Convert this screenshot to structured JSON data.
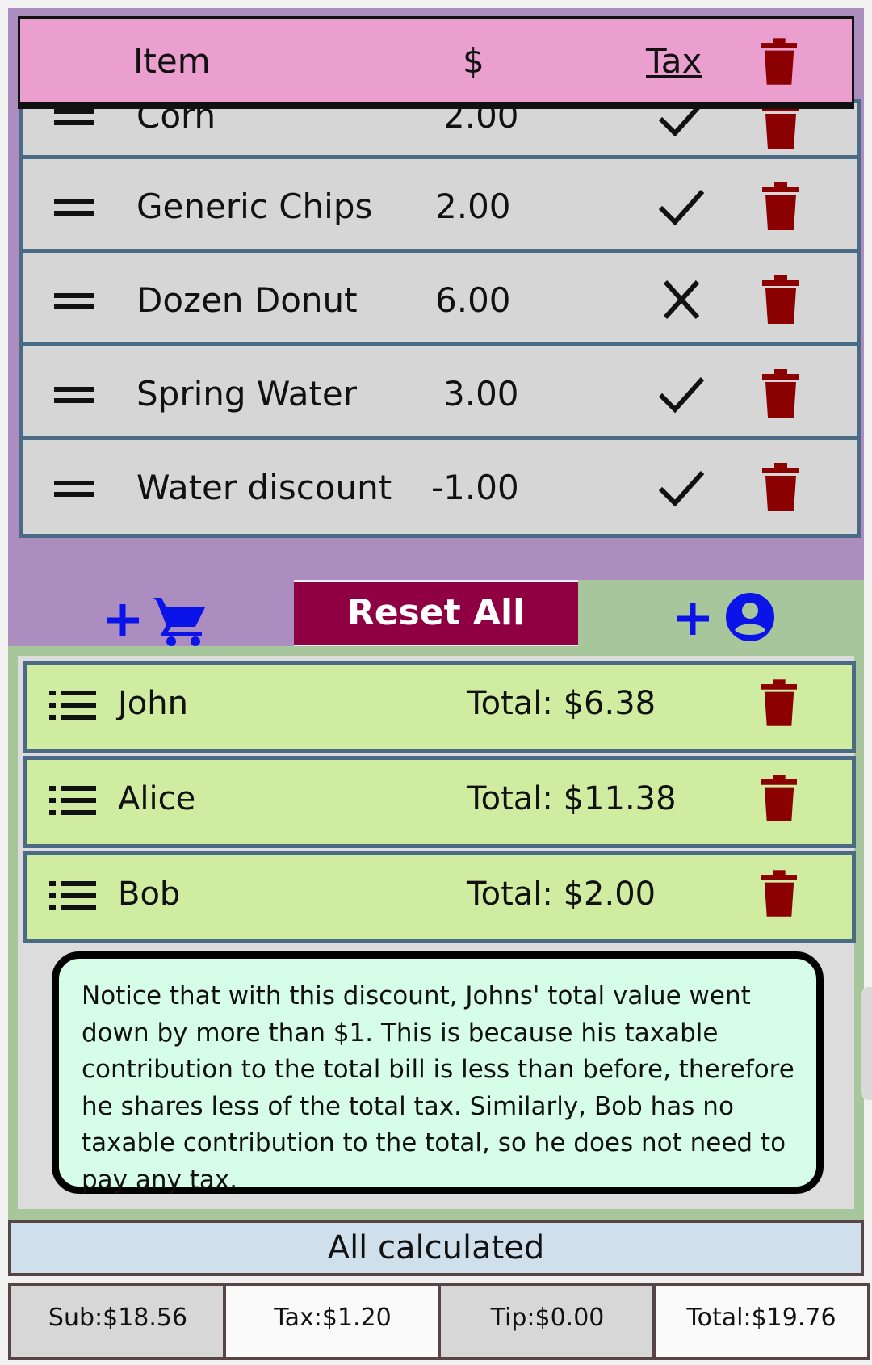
{
  "header": {
    "item": "Item",
    "price": "$",
    "tax": "Tax"
  },
  "items": [
    {
      "name": "Corn",
      "price": "2.00",
      "taxed": true
    },
    {
      "name": "Generic Chips",
      "price": "2.00",
      "taxed": true
    },
    {
      "name": "Dozen Donut",
      "price": "6.00",
      "taxed": false
    },
    {
      "name": "Spring Water",
      "price": "3.00",
      "taxed": true
    },
    {
      "name": "Water discount",
      "price": "-1.00",
      "taxed": true
    }
  ],
  "actions": {
    "reset": "Reset All"
  },
  "people": [
    {
      "name": "John",
      "total": "Total: $6.38"
    },
    {
      "name": "Alice",
      "total": "Total: $11.38"
    },
    {
      "name": "Bob",
      "total": "Total: $2.00"
    }
  ],
  "note": "Notice that with this discount, Johns' total value went down by more than $1. This is because his taxable contribution to the total bill is less than before, therefore he shares less of the total tax. Similarly, Bob has no taxable contribution to the total, so he does not need to pay any tax.",
  "status": "All calculated",
  "summary": {
    "sub": "Sub:$18.56",
    "tax": "Tax:$1.20",
    "tip": "Tip:$0.00",
    "total": "Total:$19.76"
  },
  "colors": {
    "trash": "#8b0000",
    "accent_blue": "#0a14e8",
    "reset": "#8e0042"
  }
}
